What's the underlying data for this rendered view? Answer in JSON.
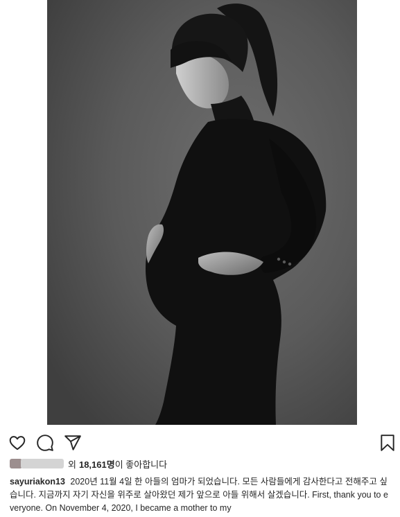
{
  "post": {
    "image_alt": "Black and white maternity portrait photo",
    "image_bg": "#575757"
  },
  "actions": {
    "like_icon": "heart-icon",
    "comment_icon": "comment-icon",
    "share_icon": "paper-plane-icon",
    "save_icon": "bookmark-icon"
  },
  "likes": {
    "prefix": "외",
    "count": "18,161명",
    "suffix": "이 좋아합니다"
  },
  "caption": {
    "username": "sayuriakon13",
    "text": "2020년 11월 4일 한 아들의 엄마가 되었습니다. 모든 사람들에게 감사한다고 전해주고 싶습니다. 지금까지 자기 자신을 위주로 살아왔던 제가 앞으로 아들 위해서 살겠습니다. First, thank you to everyone. On November 4, 2020, I became a mother to my"
  },
  "colors": {
    "text": "#262626",
    "icon": "#262626"
  }
}
